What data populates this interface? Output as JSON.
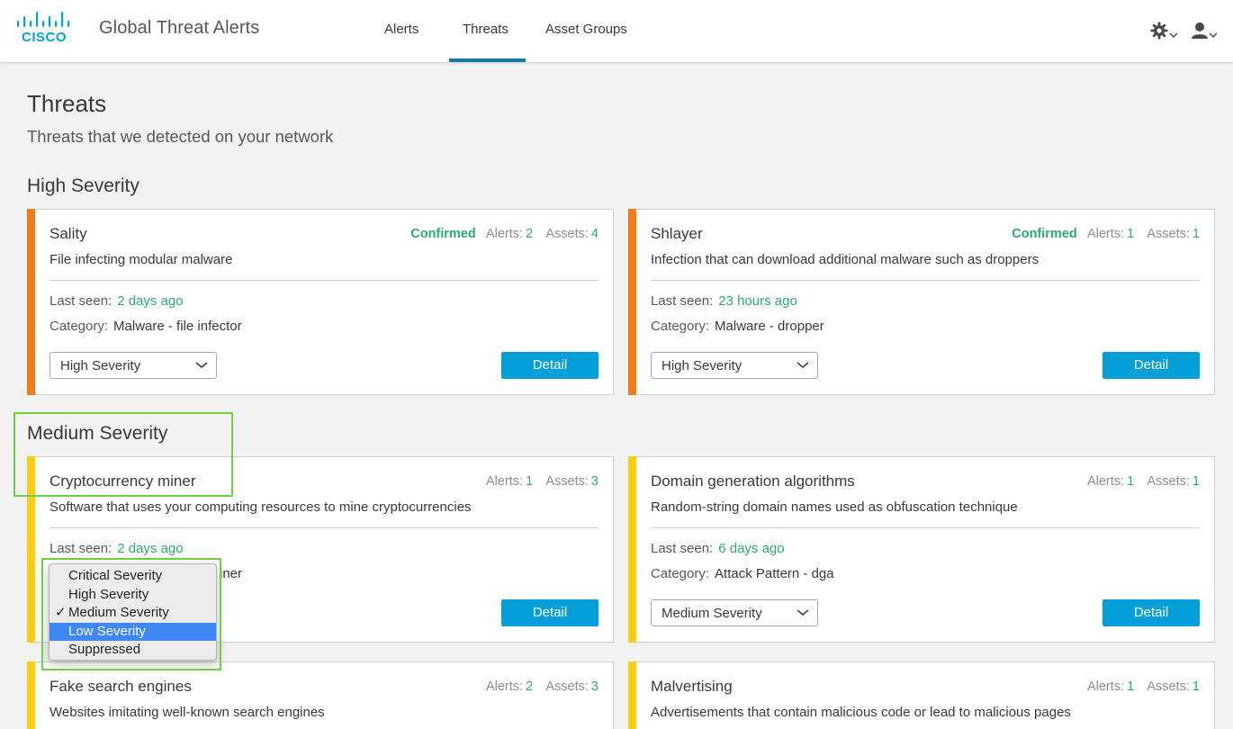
{
  "app": {
    "brand": "CISCO",
    "title": "Global Threat Alerts"
  },
  "nav": {
    "tabs": [
      {
        "label": "Alerts",
        "active": false
      },
      {
        "label": "Threats",
        "active": true
      },
      {
        "label": "Asset Groups",
        "active": false
      }
    ],
    "settings_icon": "gear-icon",
    "user_icon": "user-icon"
  },
  "page": {
    "title": "Threats",
    "subtitle": "Threats that we detected on your network"
  },
  "sections": [
    {
      "title": "High Severity",
      "color": "#f07d1a",
      "cards": [
        {
          "name": "Sality",
          "description": "File infecting modular malware",
          "confirmed": "Confirmed",
          "alerts_label": "Alerts:",
          "alerts": "2",
          "assets_label": "Assets:",
          "assets": "4",
          "last_seen_label": "Last seen:",
          "last_seen": "2 days ago",
          "category_label": "Category:",
          "category": "Malware - file infector",
          "severity": "High Severity",
          "detail_label": "Detail"
        },
        {
          "name": "Shlayer",
          "description": "Infection that can download additional malware such as droppers",
          "confirmed": "Confirmed",
          "alerts_label": "Alerts:",
          "alerts": "1",
          "assets_label": "Assets:",
          "assets": "1",
          "last_seen_label": "Last seen:",
          "last_seen": "23 hours ago",
          "category_label": "Category:",
          "category": "Malware - dropper",
          "severity": "High Severity",
          "detail_label": "Detail"
        }
      ]
    },
    {
      "title": "Medium Severity",
      "color": "#fbcd16",
      "cards": [
        {
          "name": "Cryptocurrency miner",
          "description": "Software that uses your computing resources to mine cryptocurrencies",
          "alerts_label": "Alerts:",
          "alerts": "1",
          "assets_label": "Assets:",
          "assets": "3",
          "last_seen_label": "Last seen:",
          "last_seen": "2 days ago",
          "category_partial": "iner",
          "detail_label": "Detail"
        },
        {
          "name": "Domain generation algorithms",
          "description": "Random-string domain names used as obfuscation technique",
          "alerts_label": "Alerts:",
          "alerts": "1",
          "assets_label": "Assets:",
          "assets": "1",
          "last_seen_label": "Last seen:",
          "last_seen": "6 days ago",
          "category_label": "Category:",
          "category": "Attack Pattern - dga",
          "severity": "Medium Severity",
          "detail_label": "Detail"
        },
        {
          "name": "Fake search engines",
          "description": "Websites imitating well-known search engines",
          "alerts_label": "Alerts:",
          "alerts": "2",
          "assets_label": "Assets:",
          "assets": "3"
        },
        {
          "name": "Malvertising",
          "description": "Advertisements that contain malicious code or lead to malicious pages",
          "alerts_label": "Alerts:",
          "alerts": "1",
          "assets_label": "Assets:",
          "assets": "1"
        }
      ]
    }
  ],
  "severity_dropdown": {
    "options": [
      "Critical Severity",
      "High Severity",
      "Medium Severity",
      "Low Severity",
      "Suppressed"
    ],
    "selected": "Medium Severity",
    "highlighted": "Low Severity",
    "check_mark": "✓"
  },
  "colors": {
    "accent_blue": "#049fd9",
    "nav_underline": "#0d7ab0",
    "green_value": "#2eaa6e",
    "high_stripe": "#f07d1a",
    "medium_stripe": "#fbcd16",
    "annotation": "#6fcf4a"
  }
}
